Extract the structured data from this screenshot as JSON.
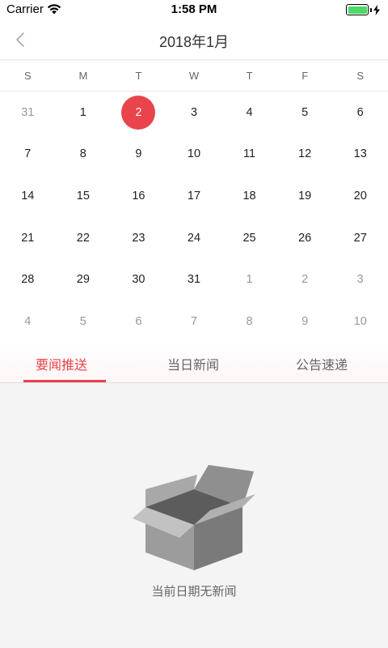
{
  "status": {
    "carrier": "Carrier",
    "time": "1:58 PM",
    "battery_level": 1.0
  },
  "header": {
    "title": "2018年1月"
  },
  "calendar": {
    "weekdays": [
      "S",
      "M",
      "T",
      "W",
      "T",
      "F",
      "S"
    ],
    "selected": "2",
    "accent": "#e9434b",
    "weeks": [
      [
        "31",
        "1",
        "2",
        "3",
        "4",
        "5",
        "6"
      ],
      [
        "7",
        "8",
        "9",
        "10",
        "11",
        "12",
        "13"
      ],
      [
        "14",
        "15",
        "16",
        "17",
        "18",
        "19",
        "20"
      ],
      [
        "21",
        "22",
        "23",
        "24",
        "25",
        "26",
        "27"
      ],
      [
        "28",
        "29",
        "30",
        "31",
        "1",
        "2",
        "3"
      ],
      [
        "4",
        "5",
        "6",
        "7",
        "8",
        "9",
        "10"
      ]
    ]
  },
  "tabs": [
    {
      "label": "要闻推送",
      "active": true
    },
    {
      "label": "当日新闻",
      "active": false
    },
    {
      "label": "公告速递",
      "active": false
    }
  ],
  "empty_state": {
    "message": "当前日期无新闻",
    "icon": "empty-box-icon"
  }
}
